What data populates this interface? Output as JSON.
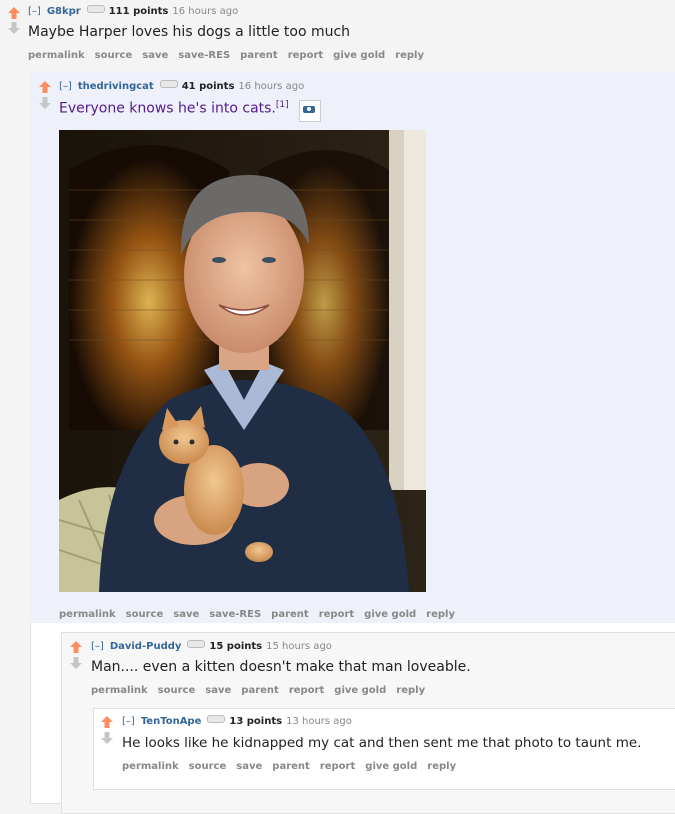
{
  "comments": [
    {
      "toggle": "[–]",
      "author": "G8kpr",
      "points": "111 points",
      "time": "16 hours ago",
      "body": "Maybe Harper loves his dogs a little too much",
      "buttons": [
        "permalink",
        "source",
        "save",
        "save-RES",
        "parent",
        "report",
        "give gold",
        "reply"
      ]
    },
    {
      "toggle": "[–]",
      "author": "thedrivingcat",
      "points": "41 points",
      "time": "16 hours ago",
      "body": "Everyone knows he's into cats.",
      "footnote": "[1]",
      "buttons": [
        "permalink",
        "source",
        "save",
        "save-RES",
        "parent",
        "report",
        "give gold",
        "reply"
      ]
    },
    {
      "toggle": "[–]",
      "author": "David-Puddy",
      "points": "15 points",
      "time": "15 hours ago",
      "body": "Man.... even a kitten doesn't make that man loveable.",
      "buttons": [
        "permalink",
        "source",
        "save",
        "parent",
        "report",
        "give gold",
        "reply"
      ]
    },
    {
      "toggle": "[–]",
      "author": "TenTonApe",
      "points": "13 points",
      "time": "13 hours ago",
      "body": "He looks like he kidnapped my cat and then sent me that photo to taunt me.",
      "buttons": [
        "permalink",
        "source",
        "save",
        "parent",
        "report",
        "give gold",
        "reply"
      ]
    }
  ],
  "colors": {
    "upvote": "#ff8b60",
    "downvote": "#c6c6c6",
    "author": "#336699",
    "visited_link": "#551a8b"
  },
  "icons": {
    "upvote": "upvote-arrow-icon",
    "downvote": "downvote-arrow-icon",
    "res_toggle": "res-toggle-icon",
    "image_expando": "image-expando-icon"
  }
}
